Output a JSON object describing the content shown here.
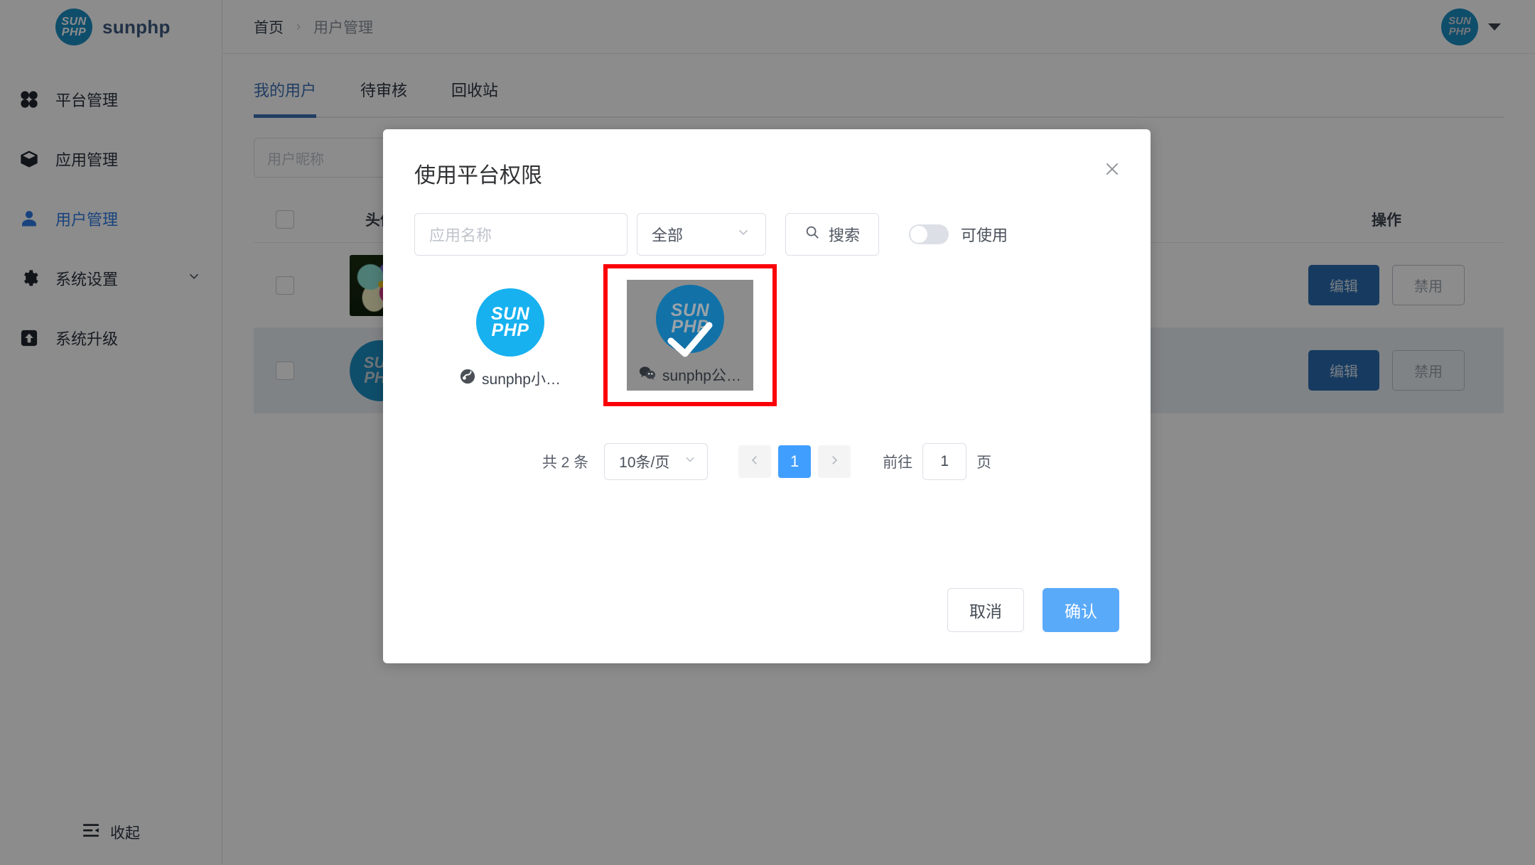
{
  "sidebar": {
    "brand_name": "sunphp",
    "logo_line1": "SUN",
    "logo_line2": "PHP",
    "items": [
      {
        "label": "平台管理",
        "icon": "grid-icon"
      },
      {
        "label": "应用管理",
        "icon": "cube-icon"
      },
      {
        "label": "用户管理",
        "icon": "user-icon"
      },
      {
        "label": "系统设置",
        "icon": "gear-icon"
      },
      {
        "label": "系统升级",
        "icon": "upload-icon"
      }
    ],
    "collapse_label": "收起"
  },
  "topbar": {
    "breadcrumb_home": "首页",
    "breadcrumb_separator": "›",
    "breadcrumb_current": "用户管理",
    "avatar_line1": "SUN",
    "avatar_line2": "PHP"
  },
  "content": {
    "tabs": [
      {
        "label": "我的用户",
        "active": true
      },
      {
        "label": "待审核",
        "active": false
      },
      {
        "label": "回收站",
        "active": false
      }
    ],
    "nickname_placeholder": "用户昵称",
    "table": {
      "headers": {
        "avatar": "头像",
        "operation": "操作"
      },
      "rows": [
        {
          "avatar_type": "photo",
          "edit_label": "编辑",
          "ban_label": "禁用"
        },
        {
          "avatar_type": "sunphp",
          "edit_label": "编辑",
          "ban_label": "禁用"
        }
      ]
    }
  },
  "modal": {
    "title": "使用平台权限",
    "close_icon": "close-icon",
    "search": {
      "app_name_placeholder": "应用名称",
      "type_selected": "全部",
      "search_button": "搜索",
      "toggle_label": "可使用",
      "toggle_on": false
    },
    "cards": [
      {
        "name": "sunphp小…",
        "logo_line1": "SUN",
        "logo_line2": "PHP",
        "badge_icon": "miniprogram-icon",
        "selected": false
      },
      {
        "name": "sunphp公…",
        "logo_line1": "SUN",
        "logo_line2": "PHP",
        "badge_icon": "wechat-icon",
        "selected": true
      }
    ],
    "pagination": {
      "total_text": "共 2 条",
      "page_size": "10条/页",
      "prev_icon": "chevron-left-icon",
      "next_icon": "chevron-right-icon",
      "current_page": "1",
      "goto_label": "前往",
      "goto_value": "1",
      "goto_unit": "页"
    },
    "footer": {
      "cancel_label": "取消",
      "confirm_label": "确认"
    }
  },
  "annotation": {
    "highlight_color": "#fb0007"
  }
}
